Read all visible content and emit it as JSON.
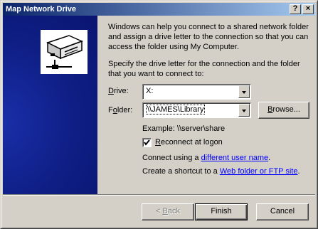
{
  "window": {
    "title": "Map Network Drive",
    "help_glyph": "?",
    "close_glyph": "×"
  },
  "intro": [
    "Windows can help you connect to a shared network folder",
    "and assign a drive letter to the connection so that you can",
    "access the folder using My Computer."
  ],
  "instruction": [
    "Specify the drive letter for the connection and the folder",
    "that you want to connect to:"
  ],
  "drive": {
    "label_accel": "D",
    "label_rest": "rive:",
    "value": "X:"
  },
  "folder": {
    "label_accel": "o",
    "label_pre": "F",
    "label_rest": "lder:",
    "value": "\\\\JAMES\\Library",
    "browse_accel": "B",
    "browse_rest": "rowse..."
  },
  "example": "Example: \\\\server\\share",
  "reconnect": {
    "label_pre": "",
    "label_accel": "R",
    "label_rest": "econnect at logon",
    "checked": true
  },
  "connect_using": {
    "prefix": "Connect using a ",
    "link": "different user name",
    "suffix": "."
  },
  "shortcut": {
    "prefix": "Create a shortcut to a ",
    "link": "Web folder or FTP site",
    "suffix": "."
  },
  "buttons": {
    "back_accel": "B",
    "back_pre": "< ",
    "back_rest": "ack",
    "finish": "Finish",
    "cancel": "Cancel"
  }
}
